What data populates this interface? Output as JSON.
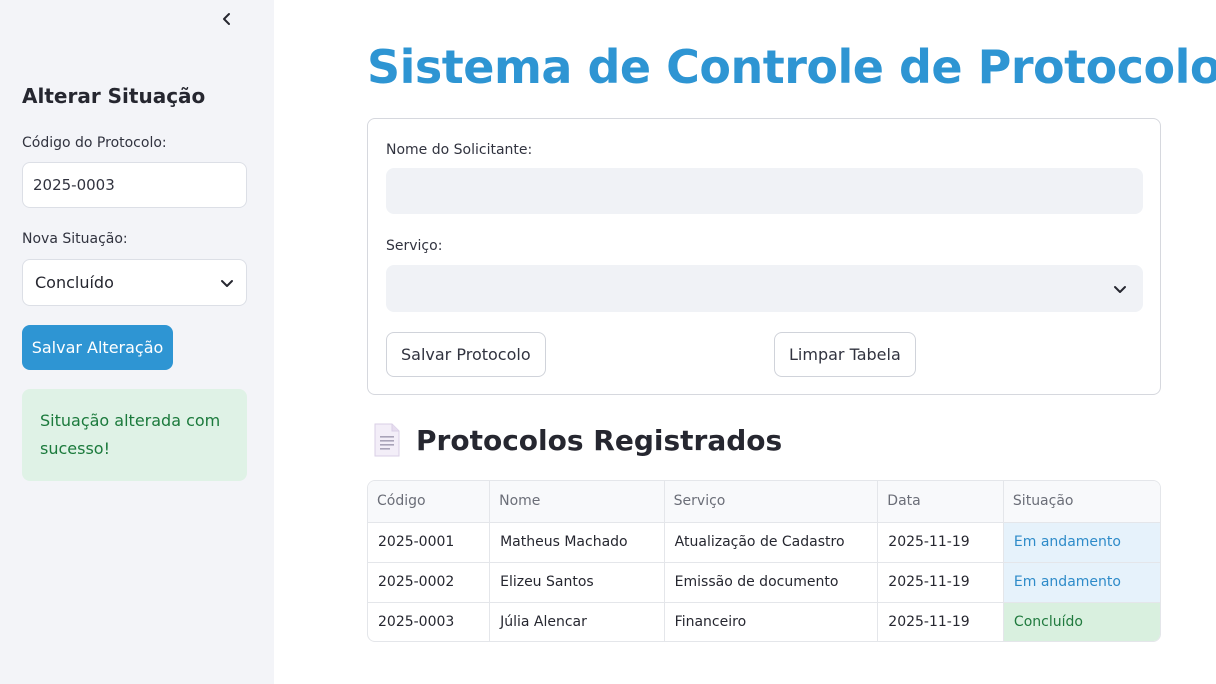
{
  "sidebar": {
    "collapse_icon": "chevron-left-icon",
    "heading": "Alterar Situação",
    "code_label": "Código do Protocolo:",
    "code_value": "2025-0003",
    "status_label": "Nova Situação:",
    "status_value": "Concluído",
    "save_button": "Salvar Alteração",
    "success_message": "Situação alterada com sucesso!"
  },
  "main": {
    "title": "Sistema de Controle de Protocolos",
    "form": {
      "name_label": "Nome do Solicitante:",
      "name_value": "",
      "service_label": "Serviço:",
      "service_value": "",
      "save_button": "Salvar Protocolo",
      "clear_button": "Limpar Tabela"
    },
    "table_section": {
      "icon": "document-icon",
      "title": "Protocolos Registrados"
    },
    "table": {
      "headers": [
        "Código",
        "Nome",
        "Serviço",
        "Data",
        "Situação"
      ],
      "rows": [
        [
          "2025-0001",
          "Matheus Machado",
          "Atualização de Cadastro",
          "2025-11-19",
          "Em andamento"
        ],
        [
          "2025-0002",
          "Elizeu Santos",
          "Emissão de documento",
          "2025-11-19",
          "Em andamento"
        ],
        [
          "2025-0003",
          "Júlia Alencar",
          "Financeiro",
          "2025-11-19",
          "Concluído"
        ]
      ]
    }
  },
  "colors": {
    "accent": "#2e95d3",
    "sidebar_bg": "#f3f4f8",
    "success_bg": "#dff2e6",
    "success_text": "#1b7a3c",
    "in_progress_bg": "#e6f2fb",
    "done_bg": "#d9f0df"
  }
}
